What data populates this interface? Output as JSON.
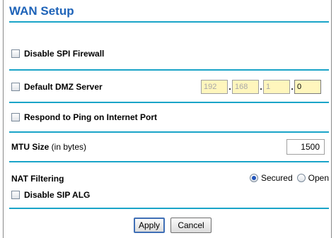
{
  "title": "WAN Setup",
  "spi_firewall": {
    "label": "Disable SPI Firewall",
    "checked": false
  },
  "dmz": {
    "label": "Default DMZ Server",
    "checked": false,
    "ip": [
      "192",
      "168",
      "1",
      "0"
    ]
  },
  "ping": {
    "label": "Respond to Ping on Internet Port",
    "checked": false
  },
  "mtu": {
    "label_bold": "MTU Size",
    "label_suffix": " (in bytes)",
    "value": "1500"
  },
  "nat": {
    "label": "NAT Filtering",
    "options": [
      "Secured",
      "Open"
    ],
    "selected": "Secured"
  },
  "sip": {
    "label": "Disable SIP ALG",
    "checked": false
  },
  "buttons": {
    "apply": "Apply",
    "cancel": "Cancel"
  },
  "colors": {
    "title": "#1e63b8",
    "rule": "#1aa4c8",
    "ip_field_bg": "#fff6bd"
  }
}
